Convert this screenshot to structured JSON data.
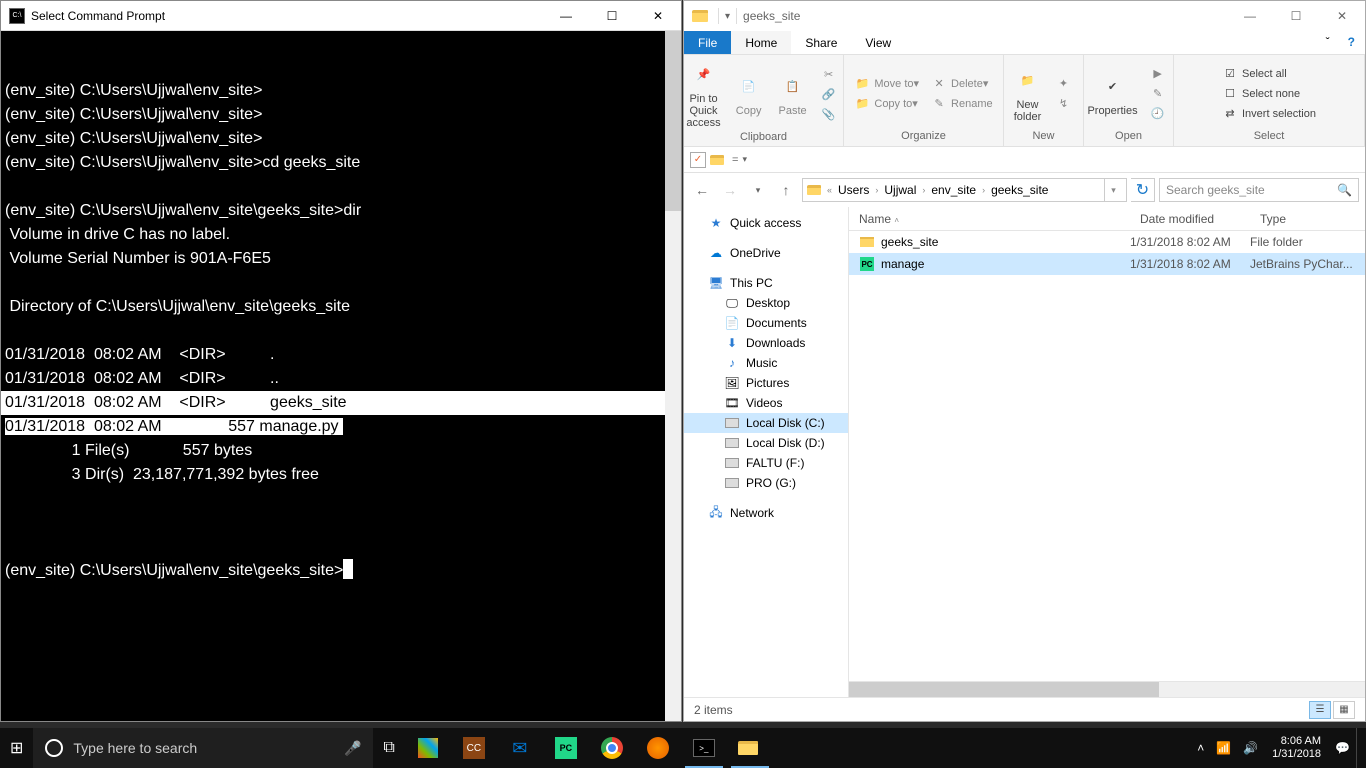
{
  "cmd": {
    "title": "Select Command Prompt",
    "lines": [
      {
        "text": "(env_site) C:\\Users\\Ujjwal\\env_site>",
        "hl": false
      },
      {
        "text": "(env_site) C:\\Users\\Ujjwal\\env_site>",
        "hl": false
      },
      {
        "text": "(env_site) C:\\Users\\Ujjwal\\env_site>",
        "hl": false
      },
      {
        "text": "(env_site) C:\\Users\\Ujjwal\\env_site>cd geeks_site",
        "hl": false
      },
      {
        "text": "",
        "hl": false
      },
      {
        "text": "(env_site) C:\\Users\\Ujjwal\\env_site\\geeks_site>dir",
        "hl": false
      },
      {
        "text": " Volume in drive C has no label.",
        "hl": false
      },
      {
        "text": " Volume Serial Number is 901A-F6E5",
        "hl": false
      },
      {
        "text": "",
        "hl": false
      },
      {
        "text": " Directory of C:\\Users\\Ujjwal\\env_site\\geeks_site",
        "hl": false
      },
      {
        "text": "",
        "hl": false
      },
      {
        "text": "01/31/2018  08:02 AM    <DIR>          .",
        "hl": false
      },
      {
        "text": "01/31/2018  08:02 AM    <DIR>          ..",
        "hl": false
      },
      {
        "text": "01/31/2018  08:02 AM    <DIR>          geeks_site",
        "hl": true
      },
      {
        "text": "",
        "hl": false,
        "partial": true,
        "segA": "01/31/2018  08:02 AM               557 manage.py "
      },
      {
        "text": "               1 File(s)            557 bytes",
        "hl": false
      },
      {
        "text": "               3 Dir(s)  23,187,771,392 bytes free",
        "hl": false
      },
      {
        "text": "",
        "hl": false
      }
    ],
    "prompt": "(env_site) C:\\Users\\Ujjwal\\env_site\\geeks_site>"
  },
  "explorer": {
    "title": "geeks_site",
    "tabs": {
      "file": "File",
      "home": "Home",
      "share": "Share",
      "view": "View"
    },
    "ribbon": {
      "pin": "Pin to Quick access",
      "copy": "Copy",
      "paste": "Paste",
      "cut": "Cut",
      "copypath": "Copy path",
      "pasteshort": "Paste shortcut",
      "moveto": "Move to",
      "copyto": "Copy to",
      "delete": "Delete",
      "rename": "Rename",
      "newfolder": "New folder",
      "newitem": "New item",
      "easy": "Easy access",
      "properties": "Properties",
      "open": "Open",
      "edit": "Edit",
      "history": "History",
      "selectall": "Select all",
      "selectnone": "Select none",
      "invert": "Invert selection",
      "grp_clipboard": "Clipboard",
      "grp_organize": "Organize",
      "grp_new": "New",
      "grp_open": "Open",
      "grp_select": "Select"
    },
    "breadcrumb": [
      "Users",
      "Ujjwal",
      "env_site",
      "geeks_site"
    ],
    "search_placeholder": "Search geeks_site",
    "nav": {
      "quick": "Quick access",
      "onedrive": "OneDrive",
      "thispc": "This PC",
      "desktop": "Desktop",
      "documents": "Documents",
      "downloads": "Downloads",
      "music": "Music",
      "pictures": "Pictures",
      "videos": "Videos",
      "c": "Local Disk (C:)",
      "d": "Local Disk (D:)",
      "f": "FALTU (F:)",
      "g": "PRO (G:)",
      "network": "Network"
    },
    "columns": {
      "name": "Name",
      "date": "Date modified",
      "type": "Type"
    },
    "files": [
      {
        "name": "geeks_site",
        "date": "1/31/2018 8:02 AM",
        "type": "File folder",
        "icon": "folder",
        "selected": false
      },
      {
        "name": "manage",
        "date": "1/31/2018 8:02 AM",
        "type": "JetBrains PyChar...",
        "icon": "py",
        "selected": true
      }
    ],
    "status": "2 items"
  },
  "taskbar": {
    "search_placeholder": "Type here to search",
    "time": "8:06 AM",
    "date": "1/31/2018"
  }
}
